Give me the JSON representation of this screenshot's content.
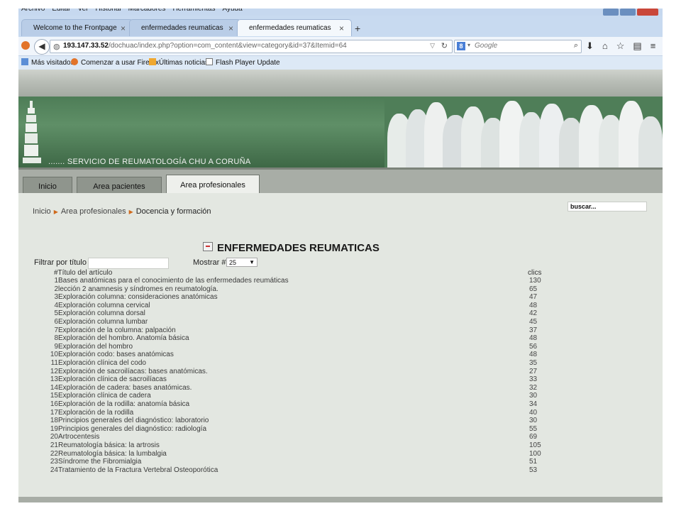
{
  "browser": {
    "menu": [
      "Archivo",
      "Editar",
      "Ver",
      "Historial",
      "Marcadores",
      "Herramientas",
      "Ayuda"
    ],
    "tabs": [
      {
        "label": "Welcome to the Frontpage",
        "active": false
      },
      {
        "label": "enfermedades reumaticas",
        "active": false
      },
      {
        "label": "enfermedades reumaticas",
        "active": true
      }
    ],
    "url_host": "193.147.33.52",
    "url_path": "/dochuac/index.php?option=com_content&view=category&id=37&Itemid=64",
    "search_placeholder": "Google",
    "bookmarks": [
      "Más visitados",
      "Comenzar a usar Firefox",
      "Últimas noticias",
      "Flash Player Update"
    ]
  },
  "site": {
    "title": "....... SERVICIO DE REUMATOLOGÍA  CHU A CORUÑA",
    "nav": [
      {
        "label": "Inicio",
        "active": false
      },
      {
        "label": "Area pacientes",
        "active": false
      },
      {
        "label": "Area profesionales",
        "active": true
      }
    ],
    "search_value": "buscar...",
    "breadcrumb": [
      "Inicio",
      "Area profesionales",
      "Docencia y formación"
    ]
  },
  "category": {
    "heading": "ENFERMEDADES REUMATICAS",
    "filter_label": "Filtrar por título",
    "show_label": "Mostrar #",
    "show_value": "25",
    "col_title": "#Título del artículo",
    "col_clicks": "clics",
    "articles": [
      {
        "n": "1",
        "title": "Bases anatómicas para el conocimiento de las enfermedades reumáticas",
        "clicks": "130"
      },
      {
        "n": "2",
        "title": "lección 2 anamnesis y síndromes en reumatología.",
        "clicks": "65"
      },
      {
        "n": "3",
        "title": "Exploración columna: consideraciones anatómicas",
        "clicks": "47"
      },
      {
        "n": "4",
        "title": "Exploración columna cervical",
        "clicks": "48"
      },
      {
        "n": "5",
        "title": "Exploración columna dorsal",
        "clicks": "42"
      },
      {
        "n": "6",
        "title": "Exploración columna lumbar",
        "clicks": "45"
      },
      {
        "n": "7",
        "title": "Exploración de la columna: palpación",
        "clicks": "37"
      },
      {
        "n": "8",
        "title": "Exploración del hombro. Anatomía básica",
        "clicks": "48"
      },
      {
        "n": "9",
        "title": "Exploración del hombro",
        "clicks": "56"
      },
      {
        "n": "10",
        "title": "Exploración codo: bases anatómicas",
        "clicks": "48"
      },
      {
        "n": "11",
        "title": "Exploración clínica del codo",
        "clicks": "35"
      },
      {
        "n": "12",
        "title": "Exploración de sacroilíacas: bases anatómicas.",
        "clicks": "27"
      },
      {
        "n": "13",
        "title": "Exploración clínica de sacroilíacas",
        "clicks": "33"
      },
      {
        "n": "14",
        "title": "Exploración de cadera: bases anatómicas.",
        "clicks": "32"
      },
      {
        "n": "15",
        "title": "Exploración clínica de cadera",
        "clicks": "30"
      },
      {
        "n": "16",
        "title": "Exploración de la rodilla: anatomía básica",
        "clicks": "34"
      },
      {
        "n": "17",
        "title": "Exploración de la rodilla",
        "clicks": "40"
      },
      {
        "n": "18",
        "title": "Principios generales del diagnóstico: laboratorio",
        "clicks": "30"
      },
      {
        "n": "19",
        "title": "Principios generales del diagnóstico: radiología",
        "clicks": "55"
      },
      {
        "n": "20",
        "title": "Artrocentesis",
        "clicks": "69"
      },
      {
        "n": "21",
        "title": "Reumatología básica: la artrosis",
        "clicks": "105"
      },
      {
        "n": "22",
        "title": "Reumatología básica: la lumbalgia",
        "clicks": "100"
      },
      {
        "n": "23",
        "title": "Síndrome the Fibromialgia",
        "clicks": "51"
      },
      {
        "n": "24",
        "title": "Tratamiento de la Fractura Vertebral Osteoporótica",
        "clicks": "53"
      }
    ]
  }
}
